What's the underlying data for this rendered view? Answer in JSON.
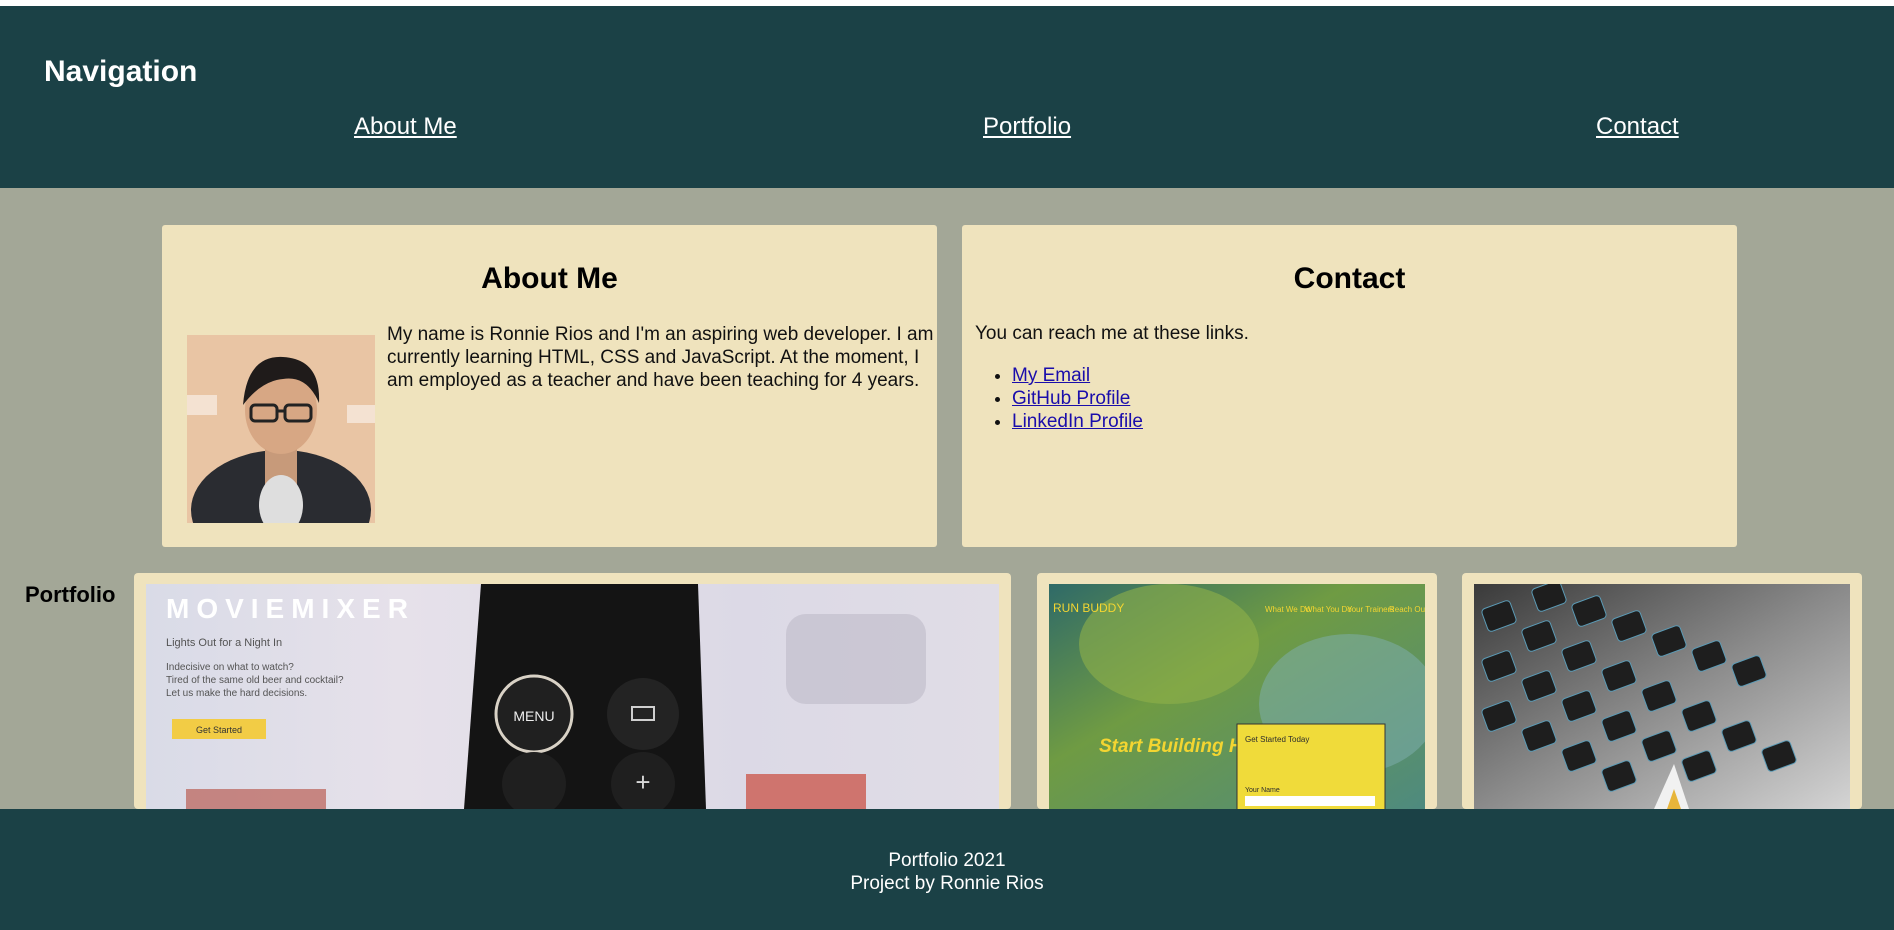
{
  "header": {
    "title": "Navigation",
    "links": [
      "About Me",
      "Portfolio",
      "Contact"
    ]
  },
  "about": {
    "title": "About Me",
    "text": "My name is Ronnie Rios and I'm an aspiring web developer. I am currently learning HTML, CSS and JavaScript. At the moment, I am employed as a teacher and have been teaching for 4 years."
  },
  "contact": {
    "title": "Contact",
    "intro": "You can reach me at these links.",
    "links": [
      "My Email",
      "GitHub Profile",
      "LinkedIn Profile"
    ]
  },
  "portfolio": {
    "label": "Portfolio",
    "projects": [
      {
        "title": "MOVIEMIXER",
        "tagline": "Lights Out for a Night In",
        "line1": "Indecisive on what to watch?",
        "line2": "Tired of the same old beer and cocktail?",
        "line3": "Let us make the hard decisions.",
        "button": "Get Started",
        "remote_menu": "MENU"
      },
      {
        "brand": "RUN BUDDY",
        "nav": [
          "What We Do",
          "What You Do",
          "Your Trainers",
          "Reach Out"
        ],
        "headline": "Start Building Habits.",
        "form_title": "Get Started Today",
        "form_field": "Your Name"
      },
      {
        "icon": "keyboard-image"
      }
    ]
  },
  "footer": {
    "line1": "Portfolio 2021",
    "line2": "Project by Ronnie Rios"
  },
  "colors": {
    "header_bg": "#1b4146",
    "page_bg": "#a3a797",
    "card_bg": "#efe3bd",
    "link": "#1a0dab"
  }
}
